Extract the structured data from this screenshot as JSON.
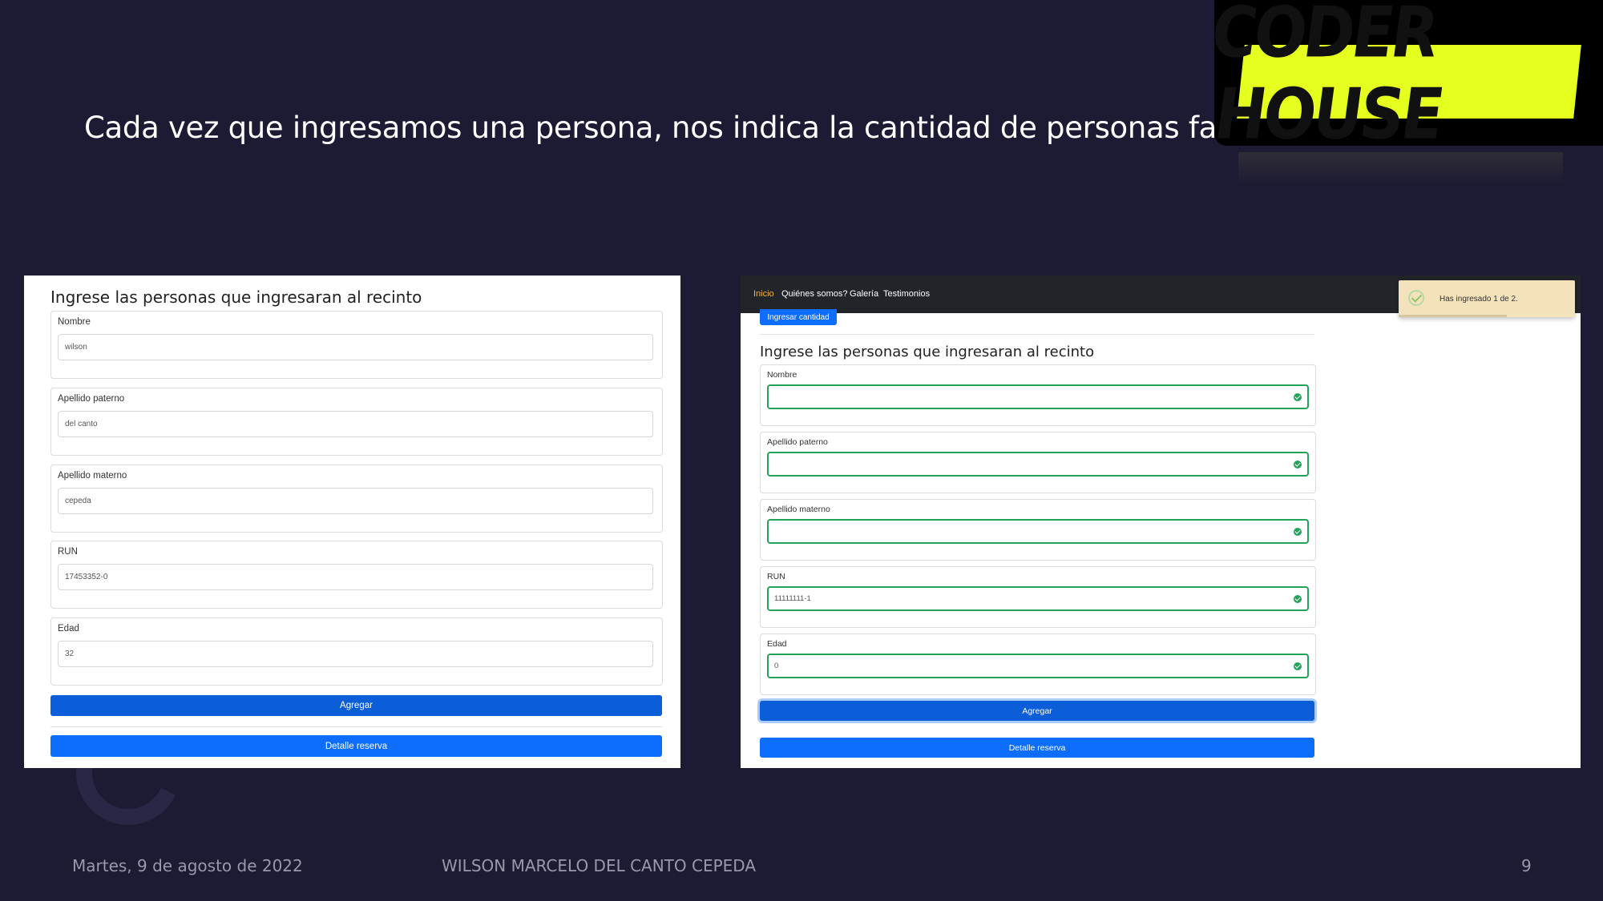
{
  "slide": {
    "title": "Cada vez que ingresamos una persona, nos indica la cantidad de personas faltantes.",
    "logo_text": "CODER HOUSE",
    "footer_date": "Martes, 9 de agosto de 2022",
    "footer_author": "WILSON MARCELO DEL CANTO CEPEDA",
    "page_number": "9"
  },
  "left_form": {
    "heading": "Ingrese las personas que ingresaran al recinto",
    "fields": [
      {
        "label": "Nombre",
        "value": "wilson"
      },
      {
        "label": "Apellido paterno",
        "value": "del canto"
      },
      {
        "label": "Apellido materno",
        "value": "cepeda"
      },
      {
        "label": "RUN",
        "value": "17453352-0"
      },
      {
        "label": "Edad",
        "value": "32"
      }
    ],
    "add_button": "Agregar",
    "detail_button": "Detalle reserva"
  },
  "right_form": {
    "nav": [
      "Inicio",
      "Quiénes somos?",
      "Galería",
      "Testimonios"
    ],
    "top_button": "Ingresar cantidad",
    "heading": "Ingrese las personas que ingresaran al recinto",
    "fields": [
      {
        "label": "Nombre",
        "value": ""
      },
      {
        "label": "Apellido paterno",
        "value": ""
      },
      {
        "label": "Apellido materno",
        "value": ""
      },
      {
        "label": "RUN",
        "value": "11111111-1"
      },
      {
        "label": "Edad",
        "value": "0"
      }
    ],
    "add_button": "Agregar",
    "detail_button": "Detalle reserva",
    "toast": "Has ingresado 1 de 2."
  },
  "colors": {
    "background": "#1d1b33",
    "primary": "#0d6efd",
    "valid": "#23a35a",
    "logo_yellow": "#e5ff1f",
    "toast": "#f3e2ba"
  }
}
